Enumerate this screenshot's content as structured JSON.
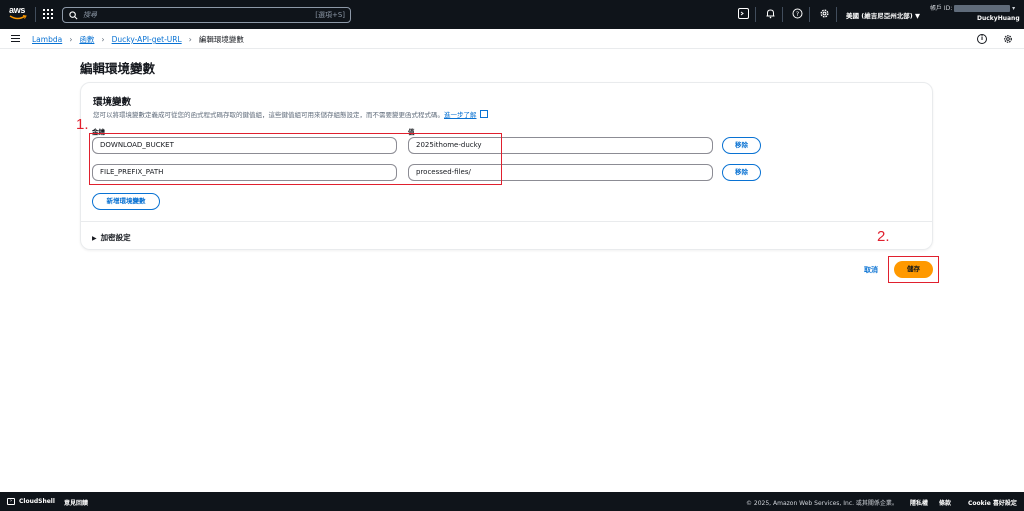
{
  "topnav": {
    "logo_text": "aws",
    "search_placeholder": "搜尋",
    "search_shortcut": "[選項+S]",
    "region": "美國 (維吉尼亞州北部) ▼",
    "account_label": "帳戶 ID:",
    "username": "DuckyHuang"
  },
  "breadcrumb": {
    "items": [
      "Lambda",
      "函數",
      "Ducky-API-get-URL"
    ],
    "current": "編輯環境變數"
  },
  "page_title": "編輯環境變數",
  "panel": {
    "heading": "環境變數",
    "description": "您可以將環境變數定義成可從您的函式程式碼存取的鍵值組，這些鍵值組可用來儲存組態設定，而不需要變更函式程式碼。",
    "learn_more": "進一步了解",
    "key_label": "金鑰",
    "value_label": "值",
    "rows": [
      {
        "key": "DOWNLOAD_BUCKET",
        "value": "2025ithome-ducky",
        "remove": "移除"
      },
      {
        "key": "FILE_PREFIX_PATH",
        "value": "processed-files/",
        "remove": "移除"
      }
    ],
    "add_button": "新增環境變數",
    "encryption": "加密設定"
  },
  "actions": {
    "cancel": "取消",
    "save": "儲存"
  },
  "annotations": {
    "step1": "1.",
    "step2": "2.",
    "color": "#e0202e"
  },
  "footer": {
    "cloudshell": "CloudShell",
    "feedback": "意見回饋",
    "copyright": "© 2025, Amazon Web Services, Inc. 或其關係企業。",
    "privacy": "隱私權",
    "terms": "條款",
    "cookie": "Cookie 喜好設定"
  },
  "colors": {
    "nav_bg": "#0f141a",
    "link": "#0972d3",
    "primary": "#ff9900"
  }
}
